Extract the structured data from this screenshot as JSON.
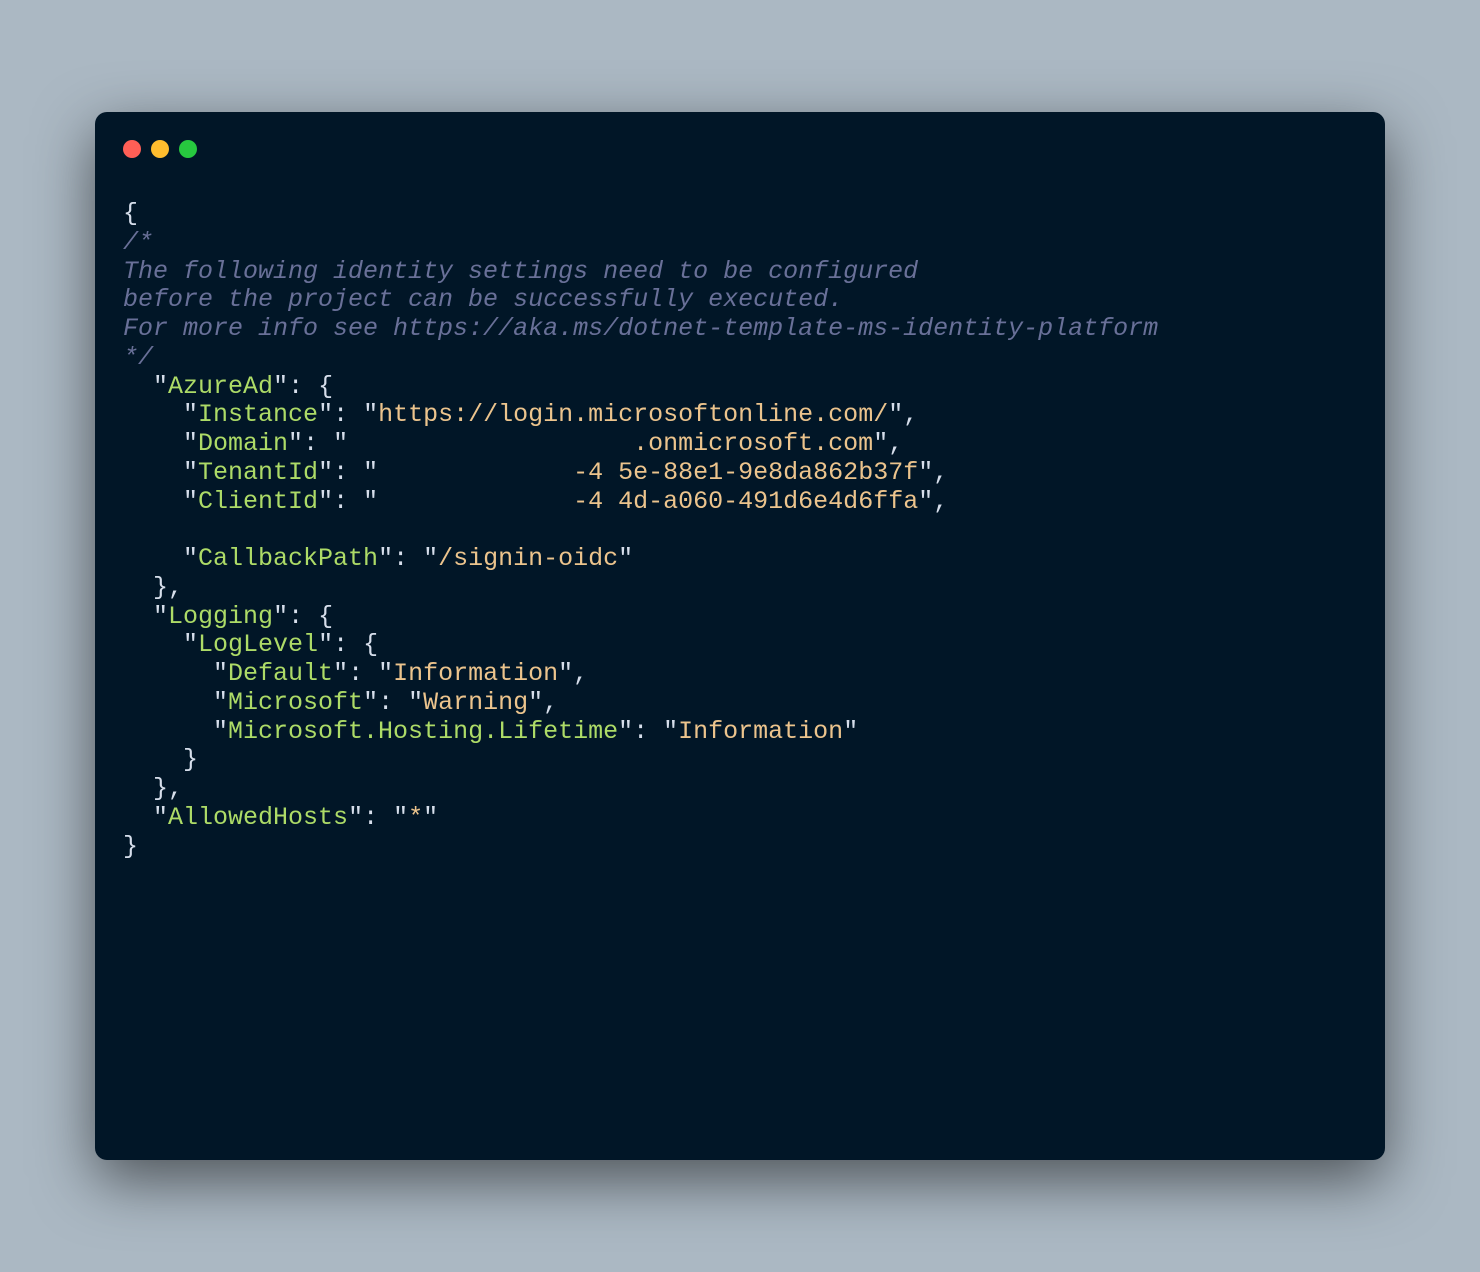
{
  "colors": {
    "page_bg": "#abb8c3",
    "window_bg": "#011627",
    "traffic_red": "#ff5f56",
    "traffic_amber": "#ffbd2e",
    "traffic_green": "#27c93f",
    "punct": "#d6deeb",
    "key": "#addb67",
    "string": "#ecc48d",
    "comment": "#697098"
  },
  "code": {
    "open_brace": "{",
    "comment_start": "/*",
    "comment_l1": "The following identity settings need to be configured",
    "comment_l2": "before the project can be successfully executed.",
    "comment_l3": "For more info see https://aka.ms/dotnet-template-ms-identity-platform",
    "comment_end": "*/",
    "q": "\"",
    "kv_sep": ": ",
    "comma": ",",
    "brace_open": "{",
    "brace_close": "}",
    "k_azuread": "AzureAd",
    "k_instance": "Instance",
    "v_instance": "https://login.microsoftonline.com/",
    "k_domain": "Domain",
    "v_domain": "                   .onmicrosoft.com",
    "k_tenantid": "TenantId",
    "v_tenantid": "             -4 5e-88e1-9e8da862b37f",
    "k_clientid": "ClientId",
    "v_clientid": "             -4 4d-a060-491d6e4d6ffa",
    "k_callback": "CallbackPath",
    "v_callback": "/signin-oidc",
    "k_logging": "Logging",
    "k_loglevel": "LogLevel",
    "k_default": "Default",
    "v_default": "Information",
    "k_microsoft": "Microsoft",
    "v_microsoft": "Warning",
    "k_mhl": "Microsoft.Hosting.Lifetime",
    "v_mhl": "Information",
    "k_allowed": "AllowedHosts",
    "v_allowed": "*",
    "close_brace": "}"
  }
}
